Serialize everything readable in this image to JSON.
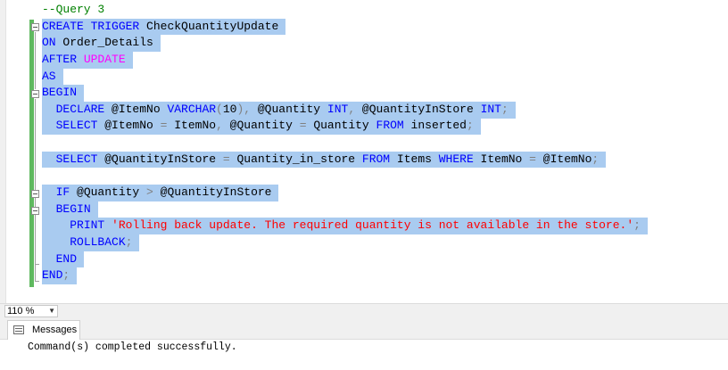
{
  "editor": {
    "lines": [
      [
        {
          "t": "--Query 3",
          "c": "cm"
        }
      ],
      [
        {
          "t": "CREATE",
          "c": "kw"
        },
        {
          "t": " ",
          "c": "tx"
        },
        {
          "t": "TRIGGER",
          "c": "kw"
        },
        {
          "t": " CheckQuantityUpdate",
          "c": "tx"
        }
      ],
      [
        {
          "t": "ON",
          "c": "kw"
        },
        {
          "t": " Order_Details",
          "c": "tx"
        }
      ],
      [
        {
          "t": "AFTER",
          "c": "kw"
        },
        {
          "t": " ",
          "c": "tx"
        },
        {
          "t": "UPDATE",
          "c": "fn"
        }
      ],
      [
        {
          "t": "AS",
          "c": "kw"
        }
      ],
      [
        {
          "t": "BEGIN",
          "c": "kw"
        }
      ],
      [
        {
          "t": "  ",
          "c": "tx"
        },
        {
          "t": "DECLARE",
          "c": "kw"
        },
        {
          "t": " @ItemNo ",
          "c": "tx"
        },
        {
          "t": "VARCHAR",
          "c": "kw"
        },
        {
          "t": "(",
          "c": "op"
        },
        {
          "t": "10",
          "c": "tx"
        },
        {
          "t": "),",
          "c": "op"
        },
        {
          "t": " @Quantity ",
          "c": "tx"
        },
        {
          "t": "INT",
          "c": "kw"
        },
        {
          "t": ",",
          "c": "op"
        },
        {
          "t": " @QuantityInStore ",
          "c": "tx"
        },
        {
          "t": "INT",
          "c": "kw"
        },
        {
          "t": ";",
          "c": "op"
        }
      ],
      [
        {
          "t": "  ",
          "c": "tx"
        },
        {
          "t": "SELECT",
          "c": "kw"
        },
        {
          "t": " @ItemNo ",
          "c": "tx"
        },
        {
          "t": "=",
          "c": "op"
        },
        {
          "t": " ItemNo",
          "c": "tx"
        },
        {
          "t": ",",
          "c": "op"
        },
        {
          "t": " @Quantity ",
          "c": "tx"
        },
        {
          "t": "=",
          "c": "op"
        },
        {
          "t": " Quantity ",
          "c": "tx"
        },
        {
          "t": "FROM",
          "c": "kw"
        },
        {
          "t": " inserted",
          "c": "tx"
        },
        {
          "t": ";",
          "c": "op"
        }
      ],
      [],
      [
        {
          "t": "  ",
          "c": "tx"
        },
        {
          "t": "SELECT",
          "c": "kw"
        },
        {
          "t": " @QuantityInStore ",
          "c": "tx"
        },
        {
          "t": "=",
          "c": "op"
        },
        {
          "t": " Quantity_in_store ",
          "c": "tx"
        },
        {
          "t": "FROM",
          "c": "kw"
        },
        {
          "t": " Items ",
          "c": "tx"
        },
        {
          "t": "WHERE",
          "c": "kw"
        },
        {
          "t": " ItemNo ",
          "c": "tx"
        },
        {
          "t": "=",
          "c": "op"
        },
        {
          "t": " @ItemNo",
          "c": "tx"
        },
        {
          "t": ";",
          "c": "op"
        }
      ],
      [],
      [
        {
          "t": "  ",
          "c": "tx"
        },
        {
          "t": "IF",
          "c": "kw"
        },
        {
          "t": " @Quantity ",
          "c": "tx"
        },
        {
          "t": ">",
          "c": "op"
        },
        {
          "t": " @QuantityInStore",
          "c": "tx"
        }
      ],
      [
        {
          "t": "  ",
          "c": "tx"
        },
        {
          "t": "BEGIN",
          "c": "kw"
        }
      ],
      [
        {
          "t": "    ",
          "c": "tx"
        },
        {
          "t": "PRINT",
          "c": "kw"
        },
        {
          "t": " ",
          "c": "tx"
        },
        {
          "t": "'Rolling back update. The required quantity is not available in the store.'",
          "c": "str"
        },
        {
          "t": ";",
          "c": "op"
        }
      ],
      [
        {
          "t": "    ",
          "c": "tx"
        },
        {
          "t": "ROLLBACK",
          "c": "kw"
        },
        {
          "t": ";",
          "c": "op"
        }
      ],
      [
        {
          "t": "  ",
          "c": "tx"
        },
        {
          "t": "END",
          "c": "kw"
        }
      ],
      [
        {
          "t": "END",
          "c": "kw"
        },
        {
          "t": ";",
          "c": "op"
        }
      ]
    ]
  },
  "zoom": {
    "value": "110 %"
  },
  "results": {
    "tab_label": "Messages",
    "message": "Command(s) completed successfully."
  }
}
